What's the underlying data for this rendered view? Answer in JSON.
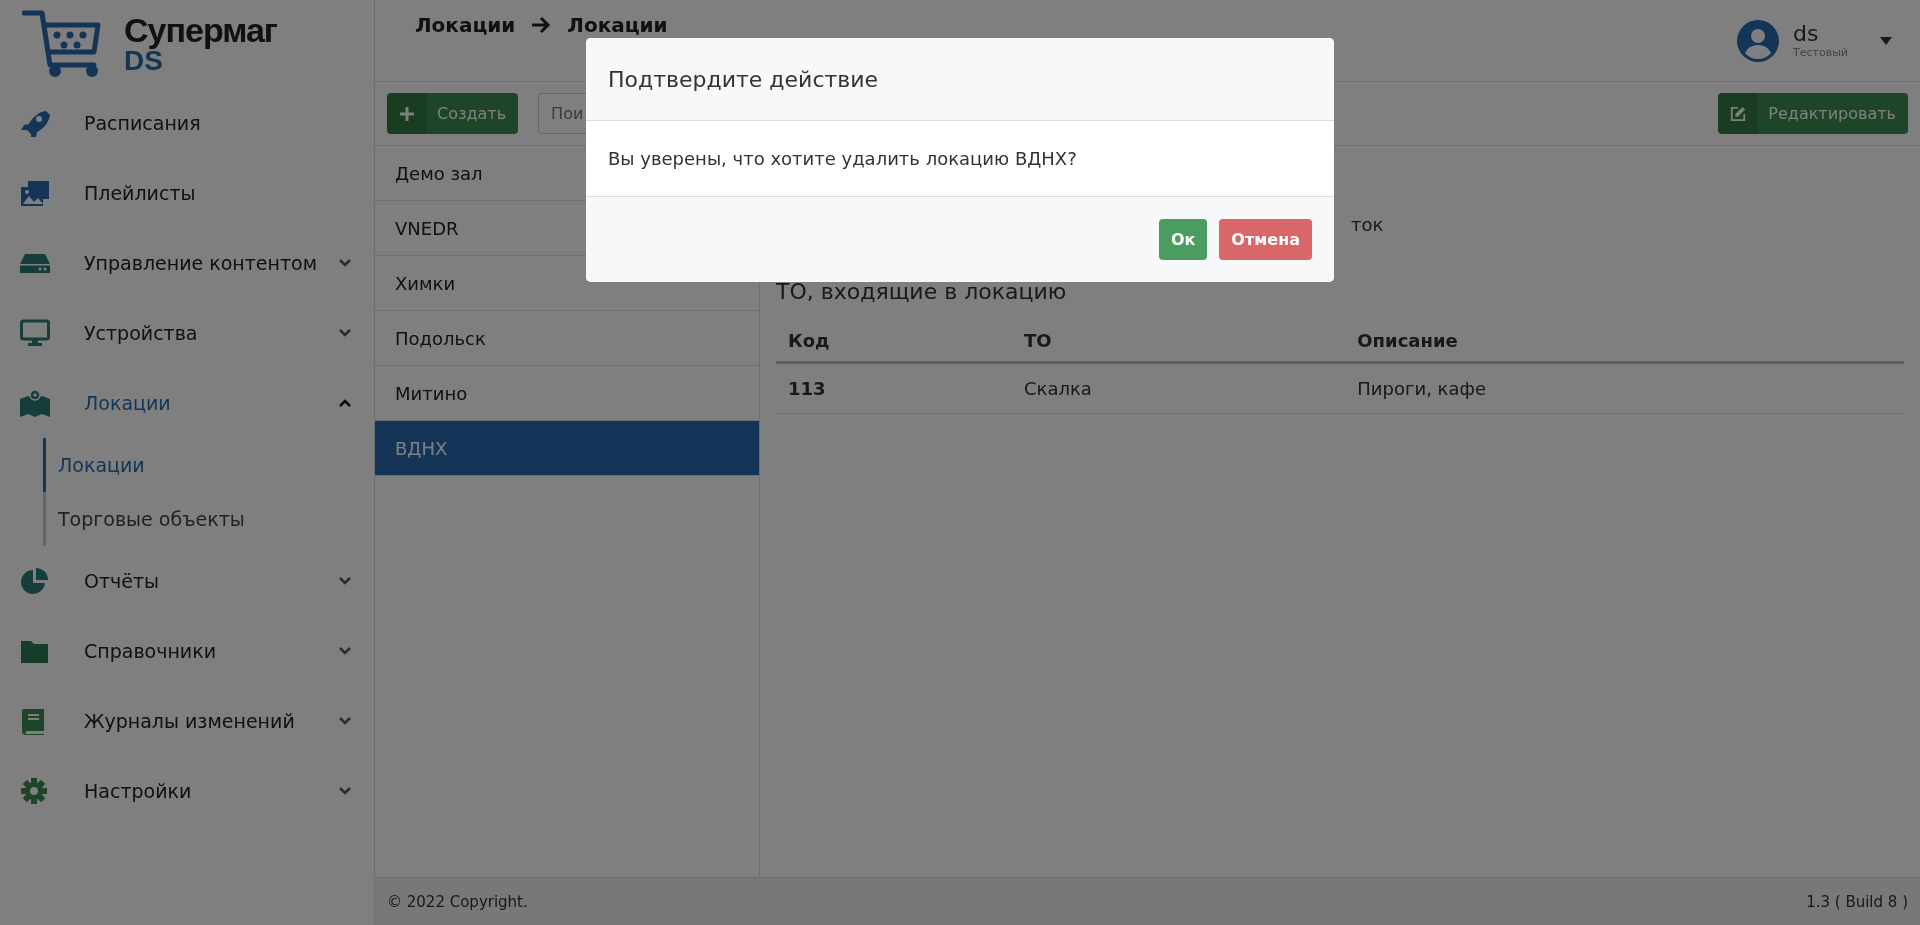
{
  "logo": {
    "title": "Супермаг",
    "subtitle": "DS"
  },
  "sidebar": {
    "items": [
      {
        "label": "Расписания",
        "kind": "link",
        "selected": false
      },
      {
        "label": "Плейлисты",
        "kind": "link",
        "selected": false
      },
      {
        "label": "Управление контентом",
        "kind": "group",
        "expanded": false,
        "selected": false
      },
      {
        "label": "Устройства",
        "kind": "group",
        "expanded": false,
        "selected": false
      },
      {
        "label": "Локации",
        "kind": "group",
        "expanded": true,
        "selected": true,
        "children": [
          {
            "label": "Локации",
            "selected": true
          },
          {
            "label": "Торговые объекты",
            "selected": false
          }
        ]
      },
      {
        "label": "Отчёты",
        "kind": "group",
        "expanded": false,
        "selected": false
      },
      {
        "label": "Справочники",
        "kind": "group",
        "expanded": false,
        "selected": false
      },
      {
        "label": "Журналы изменений",
        "kind": "group",
        "expanded": false,
        "selected": false
      },
      {
        "label": "Настройки",
        "kind": "group",
        "expanded": false,
        "selected": false
      }
    ]
  },
  "header": {
    "breadcrumb": [
      "Локации",
      "Локации"
    ],
    "user": {
      "name": "ds",
      "role": "Тестовый"
    }
  },
  "toolbar": {
    "create_button": "Создать",
    "search": {
      "placeholder": "Пои"
    },
    "edit_button": "Редактировать"
  },
  "locations": [
    {
      "label": "Демо зал",
      "selected": false
    },
    {
      "label": "VNEDR",
      "selected": false
    },
    {
      "label": "Химки",
      "selected": false
    },
    {
      "label": "Подольск",
      "selected": false
    },
    {
      "label": "Митино",
      "selected": false
    },
    {
      "label": "ВДНХ",
      "selected": true
    }
  ],
  "detail": {
    "partial_text": "ток",
    "section_title": "ТО, входящие в локацию",
    "table": {
      "columns": [
        "Код",
        "ТО",
        "Описание"
      ],
      "rows": [
        [
          "113",
          "Скалка",
          "Пироги, кафе"
        ]
      ]
    }
  },
  "footer": {
    "copyright": "© 2022 Copyright.",
    "version": "1.3 ( Build 8 )"
  },
  "modal": {
    "title": "Подтвердите действие",
    "message": "Вы уверены, что хотите удалить локацию ВДНХ?",
    "buttons": [
      {
        "label": "Ок",
        "kind": "confirm"
      },
      {
        "label": "Отмена",
        "kind": "cancel"
      }
    ]
  }
}
